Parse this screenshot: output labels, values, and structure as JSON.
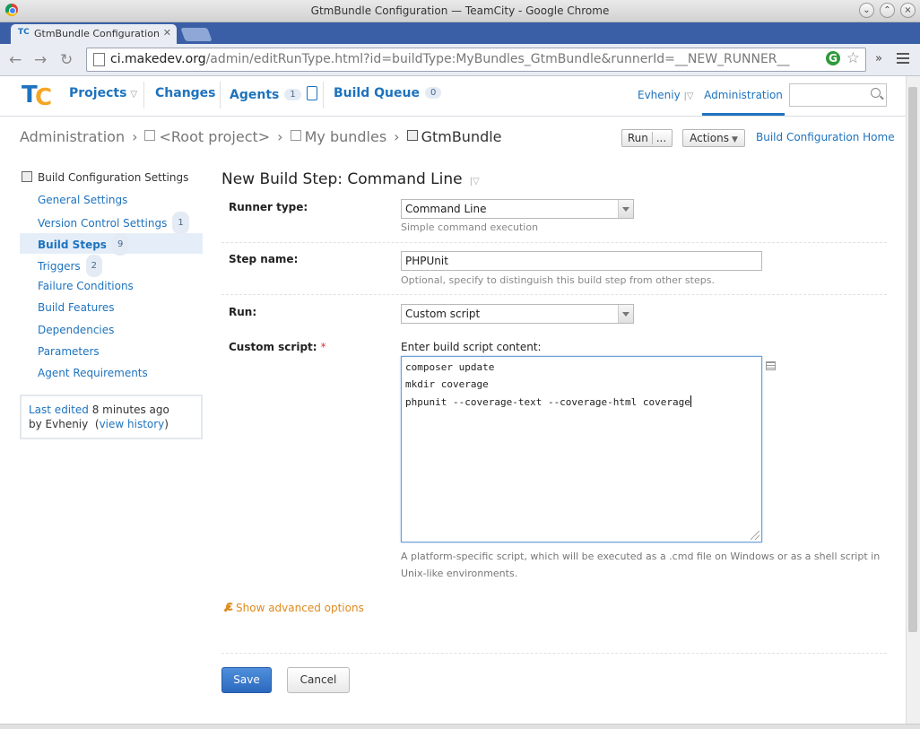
{
  "window": {
    "title": "GtmBundle Configuration — TeamCity - Google Chrome"
  },
  "browser": {
    "tab_title": "GtmBundle Configuration",
    "tab_favicon": "TC",
    "url_host": "ci.makedev.org",
    "url_path": "/admin/editRunType.html?id=buildType:MyBundles_GtmBundle&runnerId=__NEW_RUNNER__",
    "extension_letter": "G",
    "more_label": "»"
  },
  "header": {
    "logo_t": "T",
    "logo_c": "C",
    "nav": {
      "projects": "Projects",
      "changes": "Changes",
      "agents": "Agents",
      "agents_count": "1",
      "build_queue": "Build Queue",
      "build_queue_count": "0"
    },
    "user": "Evheniy",
    "administration": "Administration",
    "search_placeholder": ""
  },
  "breadcrumb": {
    "items": [
      "Administration",
      "<Root project>",
      "My bundles",
      "GtmBundle"
    ]
  },
  "actions": {
    "run": "Run",
    "run_more": "...",
    "actions": "Actions",
    "home": "Build Configuration Home"
  },
  "sidebar": {
    "title": "Build Configuration Settings",
    "items": [
      {
        "label": "General Settings",
        "badge": ""
      },
      {
        "label": "Version Control Settings",
        "badge": "1"
      },
      {
        "label": "Build Steps",
        "badge": "9"
      },
      {
        "label": "Triggers",
        "badge": "2"
      },
      {
        "label": "Failure Conditions",
        "badge": ""
      },
      {
        "label": "Build Features",
        "badge": ""
      },
      {
        "label": "Dependencies",
        "badge": ""
      },
      {
        "label": "Parameters",
        "badge": ""
      },
      {
        "label": "Agent Requirements",
        "badge": ""
      }
    ],
    "last_edited": {
      "prefix": "Last edited",
      "when": "8 minutes ago",
      "by": "by Evheniy",
      "history_link": "view history"
    }
  },
  "form": {
    "title": "New Build Step: Command Line",
    "runner_type": {
      "label": "Runner type:",
      "value": "Command Line",
      "hint": "Simple command execution"
    },
    "step_name": {
      "label": "Step name:",
      "value": "PHPUnit",
      "hint": "Optional, specify to distinguish this build step from other steps."
    },
    "run": {
      "label": "Run:",
      "value": "Custom script"
    },
    "custom_script": {
      "label": "Custom script:",
      "required_mark": "*",
      "intro": "Enter build script content:",
      "lines": [
        "composer update",
        "mkdir coverage",
        "phpunit --coverage-text --coverage-html coverage"
      ],
      "description": "A platform-specific script, which will be executed as a .cmd file on Windows or as a shell script in Unix-like environments."
    },
    "advanced": "Show advanced options",
    "save": "Save",
    "cancel": "Cancel"
  },
  "colors": {
    "link": "#1e73be",
    "accent_orange": "#e08a1e",
    "primary_button": "#2c69bf"
  }
}
